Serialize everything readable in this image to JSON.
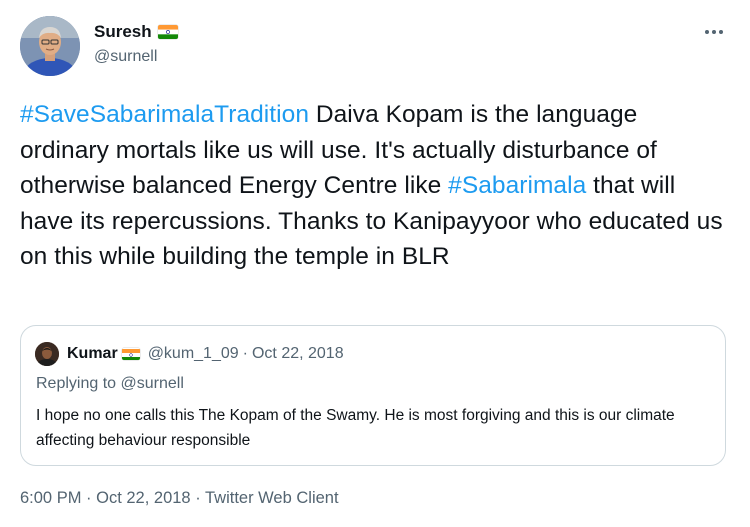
{
  "author": {
    "display_name": "Suresh",
    "flag": "india-flag-icon",
    "handle": "@surnell"
  },
  "more_icon": "more-horizontal-icon",
  "tweet": {
    "segments": [
      {
        "type": "hashtag",
        "text": "#SaveSabarimalaTradition"
      },
      {
        "type": "text",
        "text": " Daiva Kopam is the language ordinary mortals like us will use. It's actually disturbance of otherwise balanced Energy Centre like "
      },
      {
        "type": "hashtag",
        "text": "#Sabarimala"
      },
      {
        "type": "text",
        "text": " that will have its repercussions. Thanks to Kanipayyoor who educated us on this while building the temple in BLR"
      }
    ]
  },
  "quote": {
    "display_name": "Kumar",
    "handle": "@kum_1_09",
    "separator": "·",
    "date": "Oct 22, 2018",
    "replying_to": "Replying to @surnell",
    "text": "I hope no one calls this The Kopam of the Swamy. He is most forgiving and this is our climate affecting behaviour responsible"
  },
  "meta": {
    "time": "6:00 PM",
    "sep1": " · ",
    "date": "Oct 22, 2018",
    "sep2": " · ",
    "client": "Twitter Web Client"
  },
  "colors": {
    "link": "#1d9bf0",
    "secondary": "#536471",
    "text": "#0f1419",
    "border": "#cfd9de"
  }
}
